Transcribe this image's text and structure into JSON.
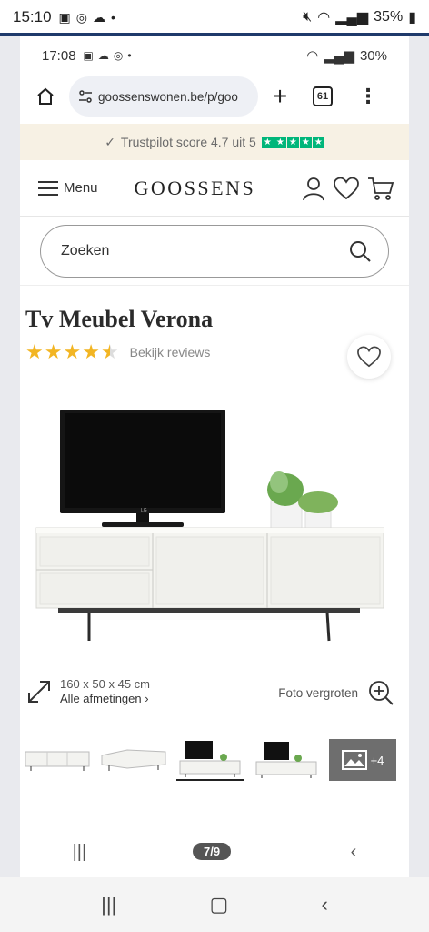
{
  "outer_status": {
    "time": "15:10",
    "battery": "35%"
  },
  "inner_status": {
    "time": "17:08",
    "battery": "30%"
  },
  "browser": {
    "url": "goossenswonen.be/p/goo",
    "tab_count": "61"
  },
  "trustbar": {
    "text": "Trustpilot score 4.7 uit 5"
  },
  "header": {
    "menu_label": "Menu",
    "logo": "GOOSSENS"
  },
  "search": {
    "placeholder": "Zoeken"
  },
  "product": {
    "title": "Tv Meubel Verona",
    "rating": 4.5,
    "reviews_link": "Bekijk reviews",
    "dimensions": "160 x 50 x 45 cm",
    "dimensions_link": "Alle afmetingen",
    "zoom_label": "Foto vergroten",
    "more_thumbs": "+4"
  },
  "gallery": {
    "pager": "7/9"
  },
  "colors": {
    "trust_bg": "#f7f1e4",
    "star": "#f2b523",
    "trustpilot_green": "#00b67a",
    "status_blue": "#1f3a6b"
  }
}
